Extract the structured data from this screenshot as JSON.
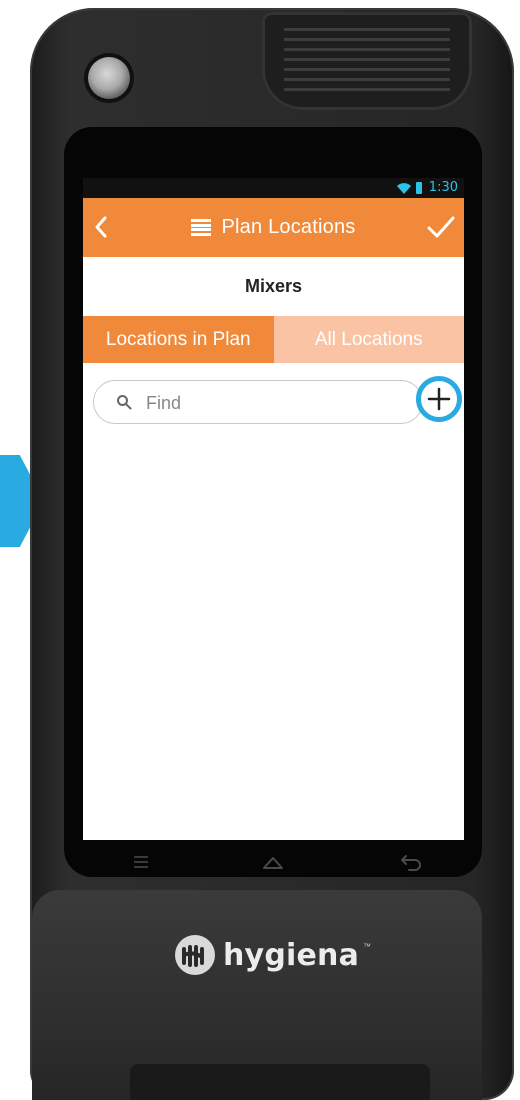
{
  "status_bar": {
    "time": "1:30"
  },
  "header": {
    "title": "Plan Locations",
    "back_icon": "chevron-left-icon",
    "menu_icon": "list-icon",
    "confirm_icon": "checkmark-icon"
  },
  "subtitle": "Mixers",
  "tabs": [
    {
      "label": "Locations in Plan",
      "active": true
    },
    {
      "label": "All Locations",
      "active": false
    }
  ],
  "search": {
    "placeholder": "Find",
    "value": ""
  },
  "add_button": {
    "icon": "plus-icon",
    "highlight_color": "#29abe2"
  },
  "nav_bar": [
    "menu-icon",
    "home-icon",
    "back-arrow-icon"
  ],
  "brand": {
    "name": "hygiena",
    "trademark": "™"
  },
  "colors": {
    "accent": "#f08a3a",
    "tab_inactive": "#f9c3a4",
    "highlight": "#29abe2"
  }
}
